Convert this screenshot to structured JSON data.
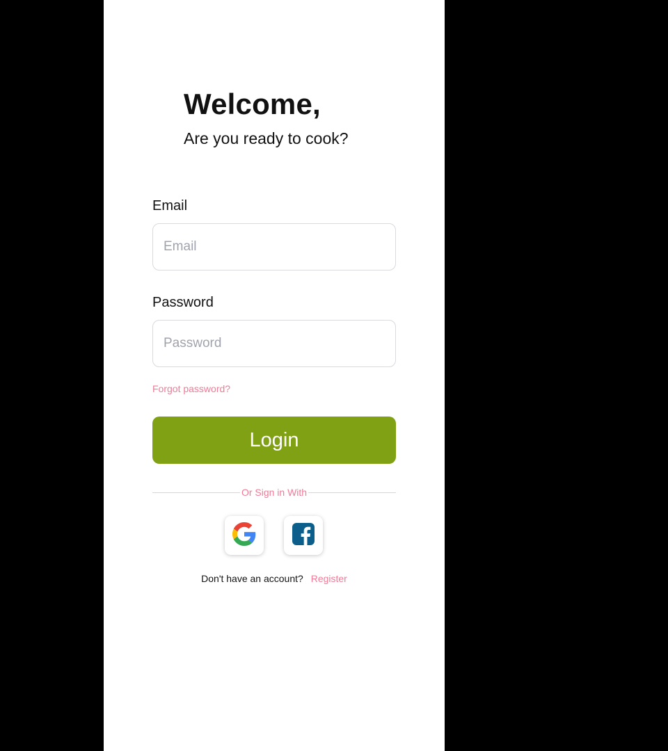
{
  "header": {
    "title": "Welcome,",
    "subtitle": "Are you ready to cook?"
  },
  "email": {
    "label": "Email",
    "placeholder": "Email",
    "value": ""
  },
  "password": {
    "label": "Password",
    "placeholder": "Password",
    "value": ""
  },
  "links": {
    "forgot": "Forgot password?"
  },
  "login": {
    "label": "Login"
  },
  "social": {
    "divider_text": "Or Sign in With",
    "providers": [
      {
        "name": "google",
        "icon": "google-icon"
      },
      {
        "name": "facebook",
        "icon": "facebook-icon"
      }
    ]
  },
  "register": {
    "question": "Don't have an account?",
    "link": "Register"
  },
  "colors": {
    "accent": "#80a113",
    "link": "#f07a97",
    "facebook": "#0b5f8a",
    "background": "#000000",
    "panel": "#ffffff"
  }
}
